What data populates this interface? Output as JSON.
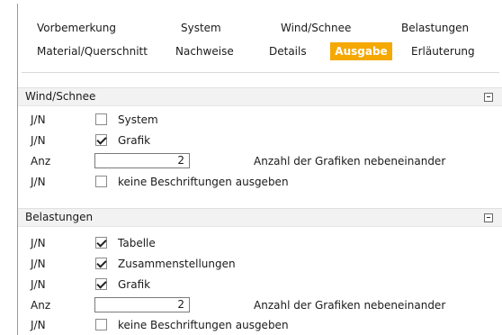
{
  "tabs": {
    "row1": [
      "Vorbemerkung",
      "System",
      "Wind/Schnee",
      "Belastungen"
    ],
    "row2": [
      "Material/Querschnitt",
      "Nachweise",
      "Details",
      "Ausgabe",
      "Erläuterung"
    ],
    "active": "Ausgabe",
    "active_color": "#f5a800"
  },
  "sections": [
    {
      "title": "Wind/Schnee",
      "collapse_icon": "collapse-minus-icon",
      "rows": [
        {
          "kind": "J/N",
          "checked": false,
          "label": "System"
        },
        {
          "kind": "J/N",
          "checked": true,
          "label": "Grafik"
        },
        {
          "kind": "Anz",
          "value": "2",
          "label": "Anzahl der Grafiken nebeneinander"
        },
        {
          "kind": "J/N",
          "checked": false,
          "label": "keine Beschriftungen ausgeben"
        }
      ]
    },
    {
      "title": "Belastungen",
      "collapse_icon": "collapse-minus-icon",
      "rows": [
        {
          "kind": "J/N",
          "checked": true,
          "label": "Tabelle"
        },
        {
          "kind": "J/N",
          "checked": true,
          "label": "Zusammenstellungen"
        },
        {
          "kind": "J/N",
          "checked": true,
          "label": "Grafik"
        },
        {
          "kind": "Anz",
          "value": "2",
          "label": "Anzahl der Grafiken nebeneinander"
        },
        {
          "kind": "J/N",
          "checked": false,
          "label": "keine Beschriftungen ausgeben"
        }
      ]
    }
  ]
}
